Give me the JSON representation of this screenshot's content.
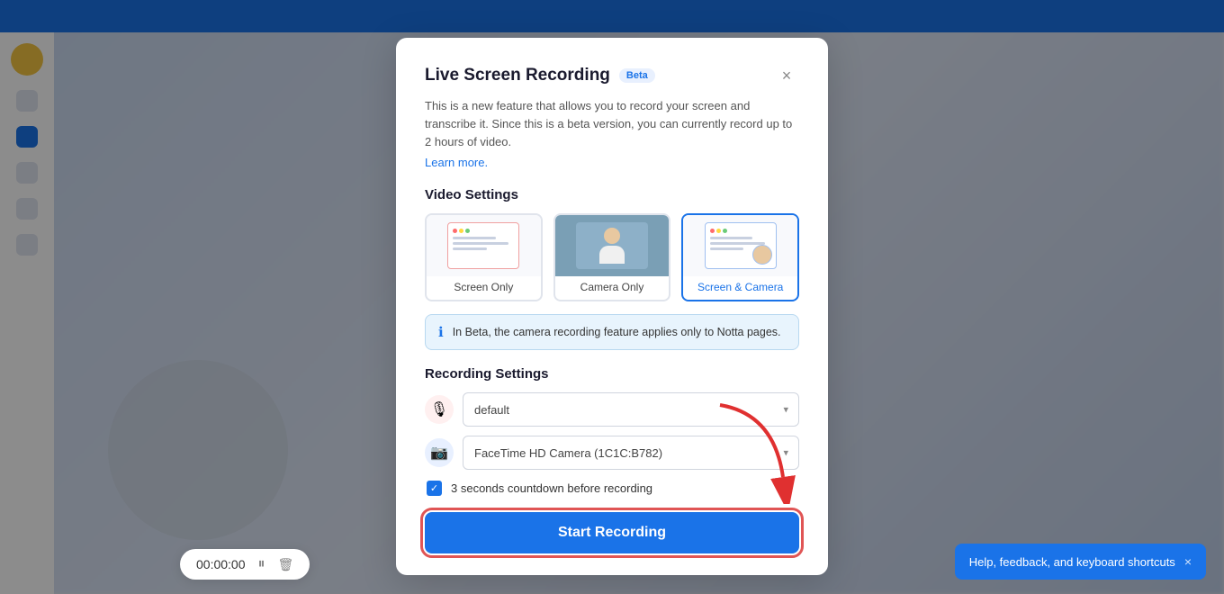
{
  "topBar": {
    "color": "#1a73e8"
  },
  "modal": {
    "title": "Live Screen Recording",
    "betaLabel": "Beta",
    "closeLabel": "×",
    "description": "This is a new feature that allows you to record your screen and transcribe it. Since this is a beta version, you can currently record up to 2 hours of video.",
    "learnMoreLabel": "Learn more.",
    "videoSettingsLabel": "Video Settings",
    "videoOptions": [
      {
        "label": "Screen Only",
        "selected": false
      },
      {
        "label": "Camera Only",
        "selected": false
      },
      {
        "label": "Screen & Camera",
        "selected": true
      }
    ],
    "infoBoxText": "In Beta, the camera recording feature applies only to Notta pages.",
    "recordingSettingsLabel": "Recording Settings",
    "micOptions": [
      {
        "value": "default",
        "label": "default"
      }
    ],
    "micPlaceholder": "default",
    "cameraOptions": [
      {
        "value": "facetime",
        "label": "FaceTime HD Camera (1C1C:B782)"
      }
    ],
    "cameraSelected": "FaceTime HD Camera (1C1C:B782)",
    "countdownLabel": "3 seconds countdown before recording",
    "countdownChecked": true,
    "startButtonLabel": "Start Recording"
  },
  "timerBar": {
    "time": "00:00:00",
    "pauseIcon": "⏸",
    "deleteIcon": "🗑"
  },
  "notification": {
    "text": "Help, feedback, and keyboard shortcuts",
    "closeLabel": "×"
  }
}
